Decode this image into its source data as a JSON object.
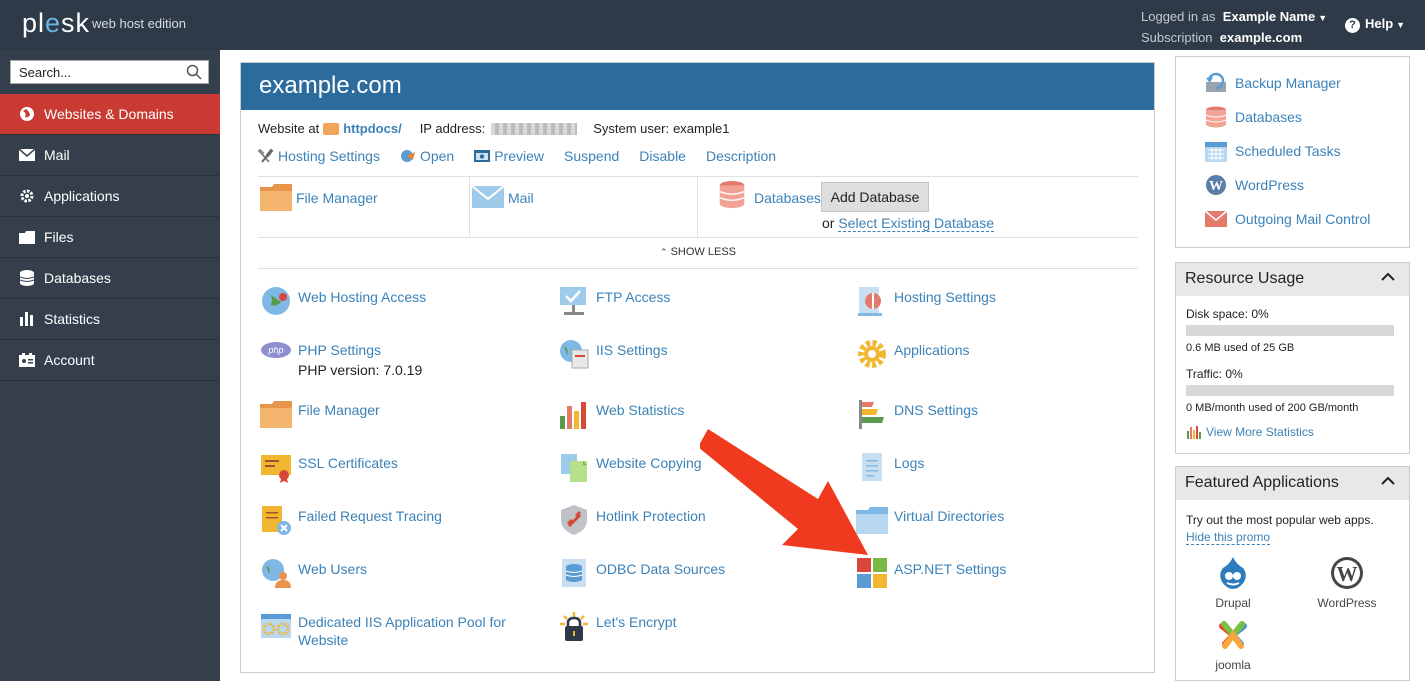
{
  "topbar": {
    "logo_text": "plesk",
    "edition": "web host edition",
    "logged_in_label": "Logged in as",
    "user_name": "Example Name",
    "subscription_label": "Subscription",
    "subscription_value": "example.com",
    "help_label": "Help"
  },
  "sidebar": {
    "search_placeholder": "Search...",
    "items": [
      {
        "label": "Websites & Domains",
        "icon": "globe-icon",
        "active": true
      },
      {
        "label": "Mail",
        "icon": "mail-icon"
      },
      {
        "label": "Applications",
        "icon": "gear-icon"
      },
      {
        "label": "Files",
        "icon": "folder-icon"
      },
      {
        "label": "Databases",
        "icon": "database-icon"
      },
      {
        "label": "Statistics",
        "icon": "bar-chart-icon"
      },
      {
        "label": "Account",
        "icon": "id-card-icon"
      }
    ]
  },
  "domain": {
    "name": "example.com",
    "website_at_label": "Website at",
    "docroot": "httpdocs/",
    "ip_label": "IP address:",
    "system_user_label": "System user:",
    "system_user": "example1"
  },
  "actions": [
    {
      "label": "Hosting Settings",
      "icon": "tools-icon"
    },
    {
      "label": "Open",
      "icon": "open-globe-icon"
    },
    {
      "label": "Preview",
      "icon": "preview-icon"
    },
    {
      "label": "Suspend"
    },
    {
      "label": "Disable"
    },
    {
      "label": "Description"
    }
  ],
  "quick": {
    "file_manager": "File Manager",
    "mail": "Mail",
    "databases": "Databases",
    "add_database": "Add Database",
    "or": "or",
    "select_existing": "Select Existing Database"
  },
  "show_less": "SHOW LESS",
  "tools": [
    {
      "label": "Web Hosting Access",
      "icon": "globe-user-icon"
    },
    {
      "label": "FTP Access",
      "icon": "ftp-icon"
    },
    {
      "label": "Hosting Settings",
      "icon": "hosting-settings-icon"
    },
    {
      "label": "PHP Settings",
      "icon": "php-icon",
      "sub": "PHP version: 7.0.19"
    },
    {
      "label": "IIS Settings",
      "icon": "iis-icon"
    },
    {
      "label": "Applications",
      "icon": "applications-gear-icon"
    },
    {
      "label": "File Manager",
      "icon": "folder-icon"
    },
    {
      "label": "Web Statistics",
      "icon": "web-statistics-icon"
    },
    {
      "label": "DNS Settings",
      "icon": "dns-icon"
    },
    {
      "label": "SSL Certificates",
      "icon": "certificate-icon"
    },
    {
      "label": "Website Copying",
      "icon": "copy-icon"
    },
    {
      "label": "Logs",
      "icon": "logs-icon"
    },
    {
      "label": "Failed Request Tracing",
      "icon": "failed-request-icon"
    },
    {
      "label": "Hotlink Protection",
      "icon": "hotlink-shield-icon"
    },
    {
      "label": "Virtual Directories",
      "icon": "virtual-folder-icon"
    },
    {
      "label": "Web Users",
      "icon": "web-users-icon"
    },
    {
      "label": "ODBC Data Sources",
      "icon": "odbc-icon"
    },
    {
      "label": "ASP.NET Settings",
      "icon": "aspnet-icon"
    },
    {
      "label": "Dedicated IIS Application Pool for Website",
      "icon": "app-pool-icon"
    },
    {
      "label": "Let's Encrypt",
      "icon": "lets-encrypt-icon"
    }
  ],
  "right_tools": [
    {
      "label": "Backup Manager",
      "icon": "backup-icon"
    },
    {
      "label": "Databases",
      "icon": "database-icon"
    },
    {
      "label": "Scheduled Tasks",
      "icon": "calendar-icon"
    },
    {
      "label": "WordPress",
      "icon": "wordpress-icon"
    },
    {
      "label": "Outgoing Mail Control",
      "icon": "mail-control-icon"
    }
  ],
  "resource_usage": {
    "title": "Resource Usage",
    "disk_label": "Disk space: 0%",
    "disk_percent": 0,
    "disk_detail": "0.6 MB used of 25 GB",
    "traffic_label": "Traffic: 0%",
    "traffic_percent": 0,
    "traffic_detail": "0 MB/month used of 200 GB/month",
    "view_more": "View More Statistics"
  },
  "featured": {
    "title": "Featured Applications",
    "intro": "Try out the most popular web apps.",
    "hide": "Hide this promo",
    "apps": [
      {
        "label": "Drupal",
        "icon": "drupal-icon"
      },
      {
        "label": "WordPress",
        "icon": "wordpress-icon"
      },
      {
        "label": "joomla",
        "icon": "joomla-icon"
      }
    ]
  },
  "colors": {
    "topbar": "#2e3a48",
    "sidebar": "#353f4c",
    "active": "#c83a32",
    "header": "#2c6c9d",
    "link": "#3b82b8",
    "arrow": "#f03a1f"
  }
}
